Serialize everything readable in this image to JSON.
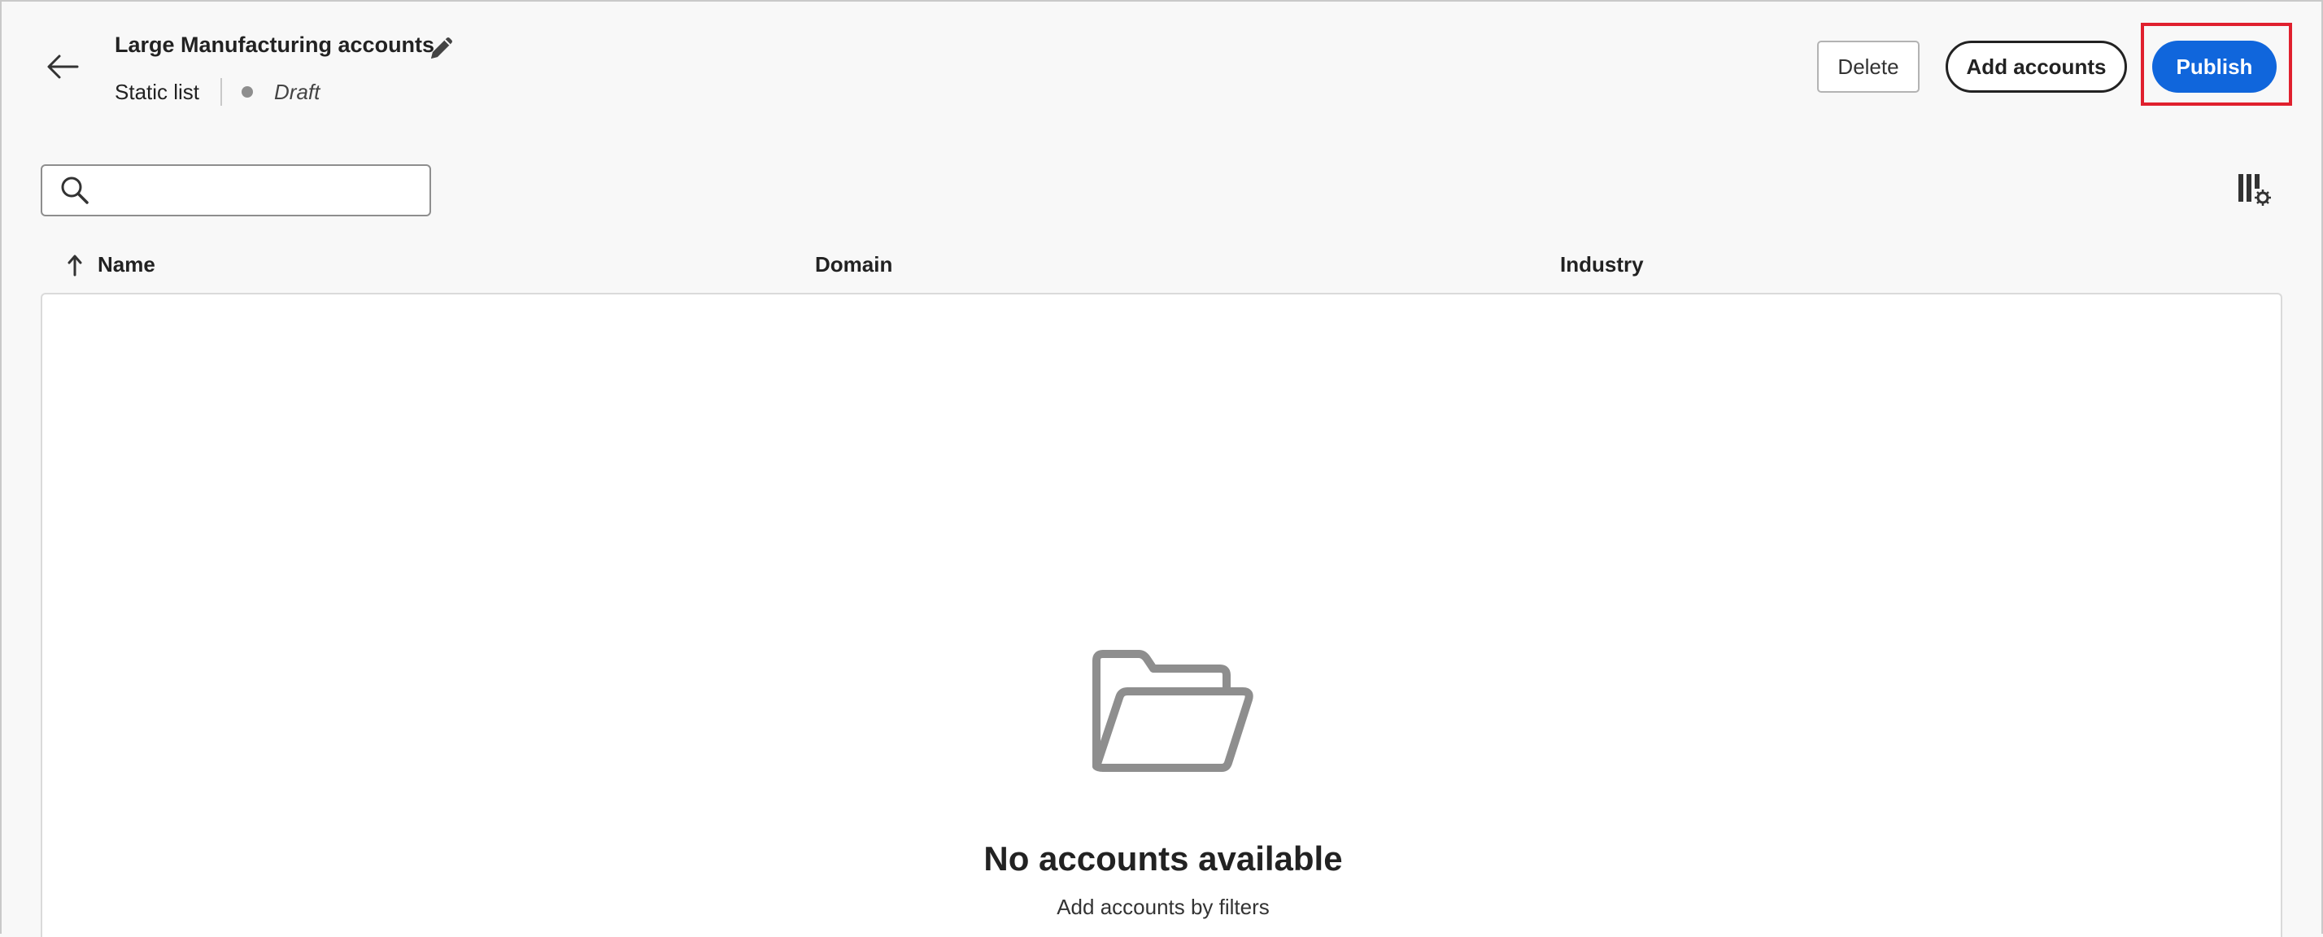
{
  "header": {
    "title": "Large Manufacturing accounts",
    "list_type": "Static list",
    "status": "Draft",
    "status_dot_color": "#8e8e8e"
  },
  "actions": {
    "delete_label": "Delete",
    "add_accounts_label": "Add accounts",
    "publish_label": "Publish",
    "publish_color": "#1066dc",
    "highlight_color": "#e0202e"
  },
  "icons": {
    "back": "arrow-left-icon",
    "edit": "pencil-icon",
    "search": "search-icon",
    "column_settings": "column-settings-icon",
    "sort": "sort-ascending-icon",
    "empty": "folder-open-icon"
  },
  "search": {
    "value": "",
    "placeholder": ""
  },
  "table": {
    "columns": [
      "Name",
      "Domain",
      "Industry"
    ],
    "sort_column": "Name",
    "sort_direction": "ascending",
    "rows": []
  },
  "empty_state": {
    "title": "No accounts available",
    "subtitle": "Add accounts by filters"
  }
}
